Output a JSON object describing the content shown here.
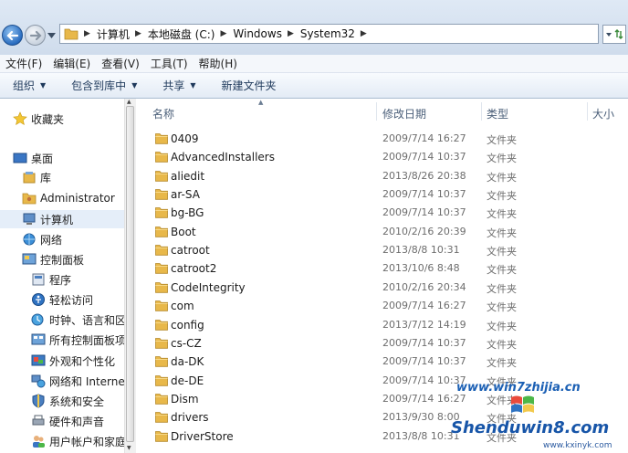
{
  "address": {
    "crumbs": [
      "计算机",
      "本地磁盘 (C:)",
      "Windows",
      "System32"
    ]
  },
  "menu": [
    "文件(F)",
    "编辑(E)",
    "查看(V)",
    "工具(T)",
    "帮助(H)"
  ],
  "toolbar": {
    "organize": "组织",
    "include_library": "包含到库中",
    "share": "共享",
    "new_folder": "新建文件夹"
  },
  "nav": {
    "favorites": "收藏夹",
    "desktop": "桌面",
    "library": "库",
    "administrator": "Administrator",
    "computer": "计算机",
    "network": "网络",
    "control_panel": "控制面板",
    "programs": "程序",
    "ease_access": "轻松访问",
    "clock_region": "时钟、语言和区",
    "all_items": "所有控制面板项",
    "appearance": "外观和个性化",
    "network_internet": "网络和 Interne",
    "system_security": "系统和安全",
    "hardware_sound": "硬件和声音",
    "user_accounts": "用户帐户和家庭"
  },
  "columns": {
    "name": "名称",
    "date": "修改日期",
    "type": "类型",
    "size": "大小"
  },
  "files": [
    {
      "name": "0409",
      "date": "2009/7/14 16:27",
      "type": "文件夹"
    },
    {
      "name": "AdvancedInstallers",
      "date": "2009/7/14 10:37",
      "type": "文件夹"
    },
    {
      "name": "aliedit",
      "date": "2013/8/26 20:38",
      "type": "文件夹"
    },
    {
      "name": "ar-SA",
      "date": "2009/7/14 10:37",
      "type": "文件夹"
    },
    {
      "name": "bg-BG",
      "date": "2009/7/14 10:37",
      "type": "文件夹"
    },
    {
      "name": "Boot",
      "date": "2010/2/16 20:39",
      "type": "文件夹"
    },
    {
      "name": "catroot",
      "date": "2013/8/8 10:31",
      "type": "文件夹"
    },
    {
      "name": "catroot2",
      "date": "2013/10/6 8:48",
      "type": "文件夹"
    },
    {
      "name": "CodeIntegrity",
      "date": "2010/2/16 20:34",
      "type": "文件夹"
    },
    {
      "name": "com",
      "date": "2009/7/14 16:27",
      "type": "文件夹"
    },
    {
      "name": "config",
      "date": "2013/7/12 14:19",
      "type": "文件夹"
    },
    {
      "name": "cs-CZ",
      "date": "2009/7/14 10:37",
      "type": "文件夹"
    },
    {
      "name": "da-DK",
      "date": "2009/7/14 10:37",
      "type": "文件夹"
    },
    {
      "name": "de-DE",
      "date": "2009/7/14 10:37",
      "type": "文件夹"
    },
    {
      "name": "Dism",
      "date": "2009/7/14 16:27",
      "type": "文件夹"
    },
    {
      "name": "drivers",
      "date": "2013/9/30 8:00",
      "type": "文件夹"
    },
    {
      "name": "DriverStore",
      "date": "2013/8/8 10:31",
      "type": "文件夹"
    }
  ],
  "watermark": {
    "site1": "www.win7zhijia.cn",
    "site2": "Shenduwin8.com",
    "site3": "www.kxinyk.com"
  },
  "colors": {
    "folder": "#e8b84a",
    "accent": "#1a5fb4"
  }
}
